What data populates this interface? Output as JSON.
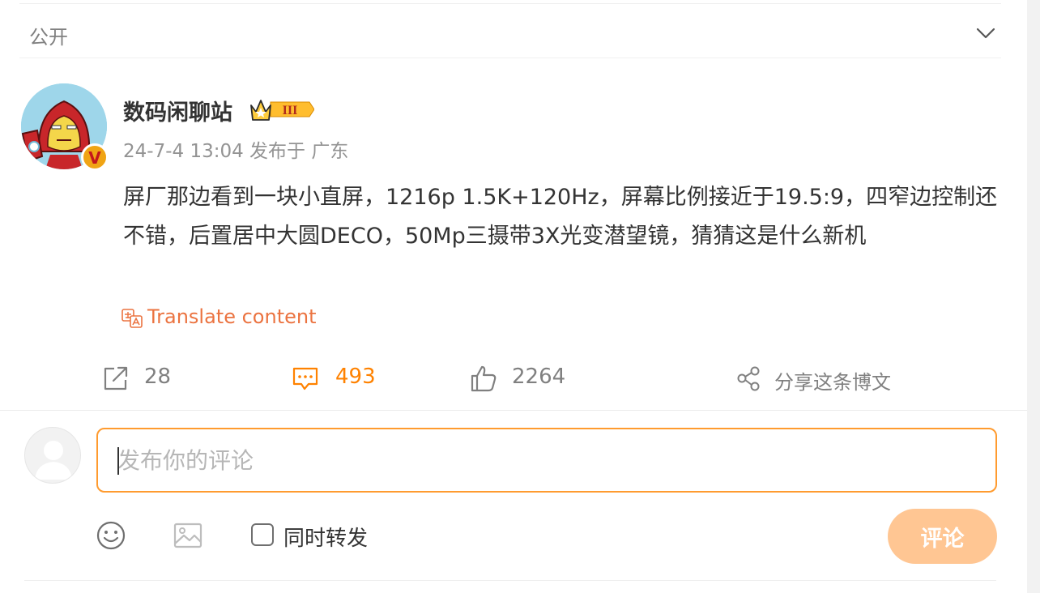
{
  "header": {
    "visibility": "公开"
  },
  "author": {
    "name": "数码闲聊站",
    "level_badge": "III",
    "verified_mark": "V"
  },
  "post": {
    "meta": "24-7-4 13:04 发布于 广东",
    "content": "屏厂那边看到一块小直屏，1216p 1.5K+120Hz，屏幕比例接近于19.5:9，四窄边控制还不错，后置居中大圆DECO，50Mp三摄带3X光变潜望镜，猜猜这是什么新机",
    "translate_label": "Translate content"
  },
  "actions": {
    "repost_count": "28",
    "comment_count": "493",
    "like_count": "2264",
    "share_label": "分享这条博文"
  },
  "composer": {
    "placeholder": "发布你的评论",
    "forward_label": "同时转发",
    "submit_label": "评论"
  },
  "colors": {
    "accent": "#ff8200",
    "translate": "#eb7340",
    "submit_disabled": "#ffc693",
    "input_border": "#ff9b2f"
  },
  "icons": [
    "chevron-down-icon",
    "translate-icon",
    "repost-icon",
    "comment-icon",
    "like-icon",
    "share-icon",
    "emoji-icon",
    "image-icon"
  ]
}
